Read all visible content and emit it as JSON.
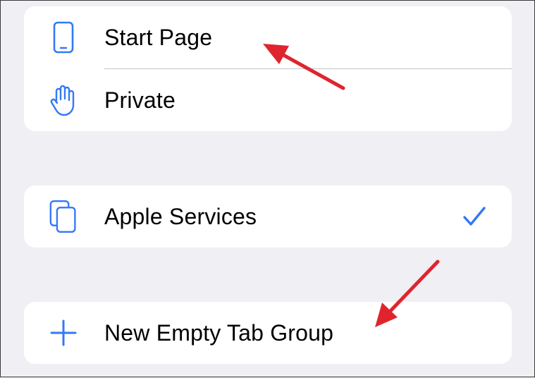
{
  "groups": [
    {
      "items": [
        {
          "icon": "phone-icon",
          "label": "Start Page"
        },
        {
          "icon": "hand-icon",
          "label": "Private"
        }
      ]
    },
    {
      "items": [
        {
          "icon": "tab-group-icon",
          "label": "Apple Services",
          "selected": true,
          "check_icon": "checkmark-icon"
        }
      ]
    },
    {
      "items": [
        {
          "icon": "plus-icon",
          "label": "New Empty Tab Group"
        }
      ]
    }
  ],
  "annotations": {
    "arrow_color": "#e0242e",
    "arrow_count": 2
  },
  "colors": {
    "background": "#efeff4",
    "card": "#ffffff",
    "accent": "#3478f6",
    "separator": "#c6c6c8",
    "text": "#000000"
  }
}
